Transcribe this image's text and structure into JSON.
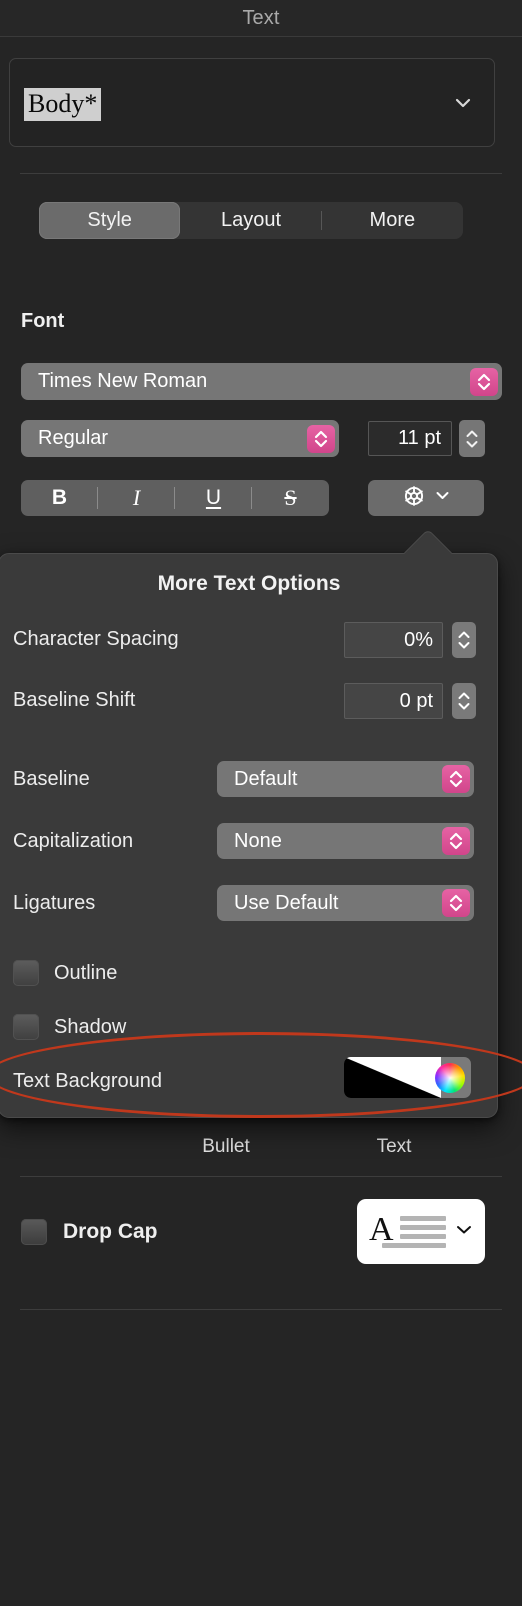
{
  "panel": {
    "title": "Text"
  },
  "style_combo": {
    "value": "Body*",
    "chevron_icon": "chevron-down-icon"
  },
  "segmented_tabs": [
    {
      "label": "Style",
      "active": true
    },
    {
      "label": "Layout",
      "active": false
    },
    {
      "label": "More",
      "active": false
    }
  ],
  "font_section": {
    "heading": "Font",
    "family": "Times New Roman",
    "style": "Regular",
    "size": "11 pt",
    "format_buttons": [
      {
        "glyph": "B",
        "name": "bold-button"
      },
      {
        "glyph": "I",
        "name": "italic-button"
      },
      {
        "glyph": "U",
        "name": "underline-button"
      },
      {
        "glyph": "S",
        "name": "strikethrough-button"
      }
    ],
    "gear_button": {
      "icon": "gear-icon",
      "chevron_icon": "chevron-down-icon"
    }
  },
  "popover": {
    "title": "More Text Options",
    "rows": [
      {
        "label": "Character Spacing",
        "value": "0%"
      },
      {
        "label": "Baseline Shift",
        "value": "0 pt"
      }
    ],
    "menus": [
      {
        "label": "Baseline",
        "value": "Default"
      },
      {
        "label": "Capitalization",
        "value": "None"
      },
      {
        "label": "Ligatures",
        "value": "Use Default"
      }
    ],
    "checkboxes": [
      {
        "label": "Outline",
        "checked": false
      },
      {
        "label": "Shadow",
        "checked": false
      }
    ],
    "text_background": {
      "label": "Text Background",
      "swatch": "black-to-white-gradient",
      "picker_icon": "color-wheel-icon"
    }
  },
  "background_labels": {
    "bullet": "Bullet",
    "text": "Text"
  },
  "drop_cap": {
    "label": "Drop Cap",
    "checked": false,
    "preview_glyph": "A",
    "chevron_icon": "chevron-down-icon"
  },
  "colors": {
    "window_background": "#252525",
    "popover_background": "#3a3a3a",
    "control_gray": "#767676",
    "accent_pink": "#e0539b",
    "highlight_annotation": "#c0381c",
    "text_primary": "#efefef",
    "text_secondary": "#a9a9a9"
  }
}
